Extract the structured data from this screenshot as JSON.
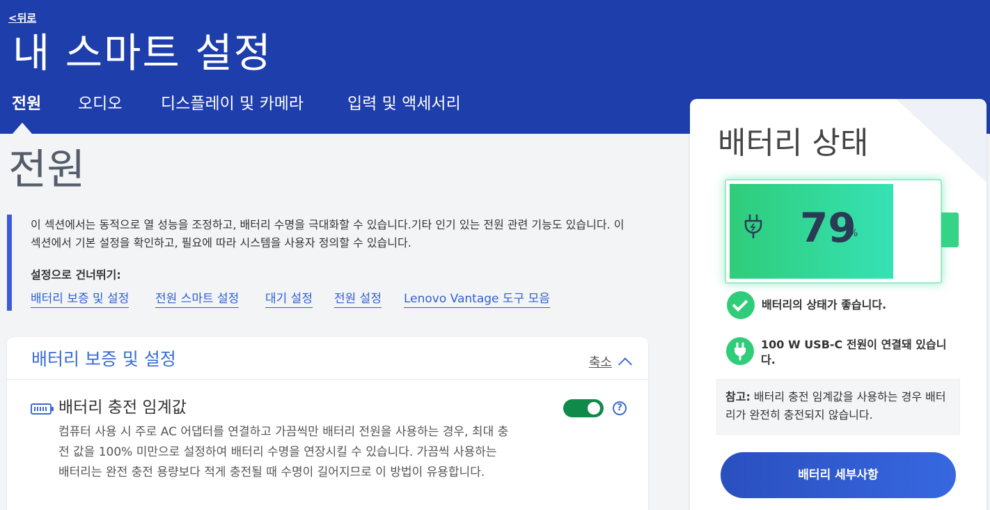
{
  "header": {
    "back_label": "<뒤로",
    "title": "내 스마트 설정",
    "tabs": [
      {
        "label": "전원",
        "active": true
      },
      {
        "label": "오디오",
        "active": false
      },
      {
        "label": "디스플레이 및 카메라",
        "active": false
      },
      {
        "label": "입력 및 액세서리",
        "active": false
      }
    ]
  },
  "main": {
    "section_title": "전원",
    "intro_text": "이 섹션에서는 동적으로 열 성능을 조정하고, 배터리 수명을 극대화할 수 있습니다.기타 인기 있는 전원 관련 기능도 있습니다. 이 섹션에서 기본 설정을 확인하고, 필요에 따라 시스템을 사용자 정의할 수 있습니다.",
    "skip_label": "설정으로 건너뛰기:",
    "skip_links": [
      "배터리 보증 및 설정",
      "전원 스마트 설정",
      "대기 설정",
      "전원 설정",
      "Lenovo Vantage 도구 모음"
    ],
    "card": {
      "title": "배터리 보증 및 설정",
      "collapse_label": "축소",
      "setting_title": "배터리 충전 임계값",
      "setting_desc": "컴퓨터 사용 시 주로 AC 어댑터를 연결하고 가끔씩만 배터리 전원을 사용하는 경우, 최대 충전 값을 100% 미만으로 설정하여 배터리 수명을 연장시킬 수 있습니다. 가끔씩 사용하는 배터리는 완전 충전 용량보다 적게 충전될 때 수명이 길어지므로 이 방법이 유용합니다.",
      "toggle_on": true,
      "help_glyph": "?"
    }
  },
  "side": {
    "title": "배터리 상태",
    "battery_percent": "79",
    "battery_level": 0.79,
    "percent_unit": "%",
    "status_good": "배터리의 상태가 좋습니다.",
    "power_status": "100 W USB-C 전원이 연결돼 있습니다.",
    "note_label": "참고:",
    "note_text": " 배터리 충전 임계값을 사용하는 경우 배터리가 완전히 충전되지 않습니다.",
    "detail_button": "배터리 세부사항"
  },
  "colors": {
    "header_bg": "#1d3eab",
    "accent": "#3a6ad4",
    "battery_green": "#2fcc7a",
    "toggle_on": "#0f8a49"
  },
  "icons": [
    "plug-icon",
    "check-icon",
    "chevron-up-icon",
    "help-icon",
    "battery-icon"
  ]
}
